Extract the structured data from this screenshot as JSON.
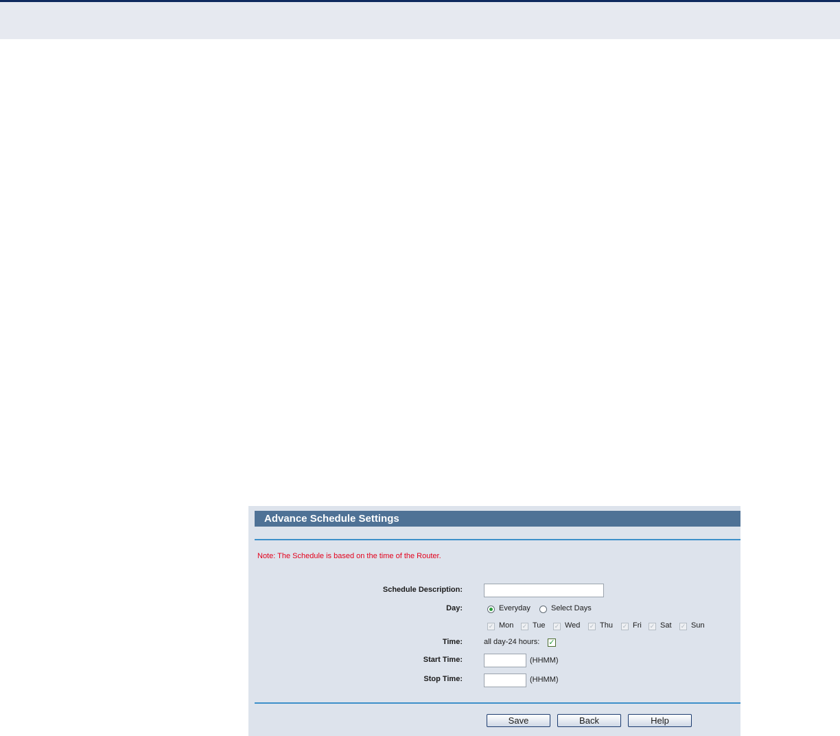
{
  "panel": {
    "title": "Advance Schedule Settings",
    "note": "Note: The Schedule is based on the time of the Router."
  },
  "form": {
    "description_label": "Schedule Description:",
    "description_value": "",
    "day_label": "Day:",
    "day_options": {
      "everyday": "Everyday",
      "select_days": "Select Days",
      "selected": "Everyday"
    },
    "days": [
      "Mon",
      "Tue",
      "Wed",
      "Thu",
      "Fri",
      "Sat",
      "Sun"
    ],
    "time_label": "Time:",
    "all_day_label": "all day-24 hours:",
    "all_day_checked": true,
    "start_label": "Start Time:",
    "start_value": "",
    "start_hint": "(HHMM)",
    "stop_label": "Stop Time:",
    "stop_value": "",
    "stop_hint": "(HHMM)"
  },
  "buttons": {
    "save": "Save",
    "back": "Back",
    "help": "Help"
  },
  "icons": {
    "radio_selected": "radio-selected-icon",
    "checkbox_checked": "checkmark-icon"
  }
}
